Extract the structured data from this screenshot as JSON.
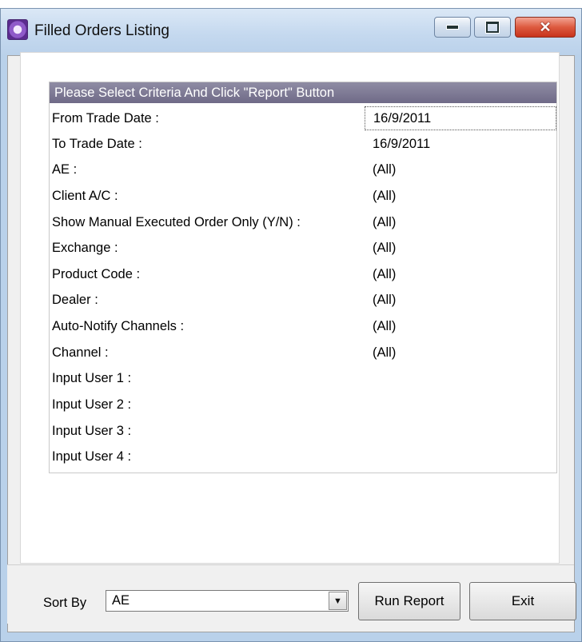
{
  "window": {
    "title": "Filled Orders Listing"
  },
  "criteria": {
    "header": "Please Select Criteria And Click \"Report\" Button",
    "rows": [
      {
        "label": "From Trade Date :",
        "value": "16/9/2011"
      },
      {
        "label": "To Trade Date :",
        "value": "16/9/2011"
      },
      {
        "label": "AE :",
        "value": "(All)"
      },
      {
        "label": "Client A/C :",
        "value": "(All)"
      },
      {
        "label": "Show Manual Executed Order Only (Y/N) :",
        "value": "(All)"
      },
      {
        "label": "Exchange :",
        "value": "(All)"
      },
      {
        "label": "Product Code :",
        "value": "(All)"
      },
      {
        "label": "Dealer :",
        "value": "(All)"
      },
      {
        "label": "Auto-Notify Channels :",
        "value": "(All)"
      },
      {
        "label": "Channel :",
        "value": "(All)"
      },
      {
        "label": "Input User 1 :",
        "value": ""
      },
      {
        "label": "Input User 2 :",
        "value": ""
      },
      {
        "label": "Input User 3 :",
        "value": ""
      },
      {
        "label": "Input User 4 :",
        "value": ""
      }
    ]
  },
  "footer": {
    "sort_label": "Sort By",
    "sort_value": "AE",
    "run_label": "Run Report",
    "exit_label": "Exit"
  }
}
